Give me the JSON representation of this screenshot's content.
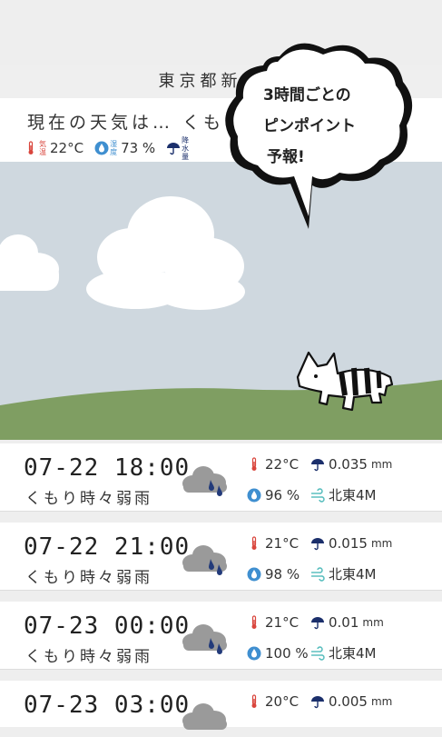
{
  "location": "東京都新宿区",
  "current": {
    "title": "現在の天気は… くもり",
    "temp_label": "気温",
    "temp": "22°C",
    "humidity_label": "湿度",
    "humidity": "73 %",
    "precip_label": "降水量"
  },
  "bubble": {
    "line1": "3時間ごとの",
    "line2": "ピンポイント",
    "line3": "予報!"
  },
  "forecast": [
    {
      "time": "07-22 18:00",
      "condition": "くもり時々弱雨",
      "temp": "22°C",
      "precip": "0.035",
      "precip_unit": "mm",
      "humidity": "96 %",
      "wind": "北東4M"
    },
    {
      "time": "07-22 21:00",
      "condition": "くもり時々弱雨",
      "temp": "21°C",
      "precip": "0.015",
      "precip_unit": "mm",
      "humidity": "98 %",
      "wind": "北東4M"
    },
    {
      "time": "07-23 00:00",
      "condition": "くもり時々弱雨",
      "temp": "21°C",
      "precip": "0.01",
      "precip_unit": "mm",
      "humidity": "100 %",
      "wind": "北東4M"
    },
    {
      "time": "07-23 03:00",
      "condition": "",
      "temp": "20°C",
      "precip": "0.005",
      "precip_unit": "mm",
      "humidity": "",
      "wind": ""
    }
  ],
  "colors": {
    "sky": "#cfd8df",
    "grass": "#7f9e62",
    "temp_icon": "#d9463d",
    "drop_icon": "#3f8fd0",
    "umbrella_icon": "#1b2f6b",
    "wind_icon": "#5cbfbf",
    "rain_drop": "#223a7a"
  },
  "icons": {
    "temp": "thermometer-icon",
    "humidity": "water-drop-icon",
    "precip": "umbrella-icon",
    "wind": "wind-icon",
    "weather": "cloud-rain-icon"
  }
}
